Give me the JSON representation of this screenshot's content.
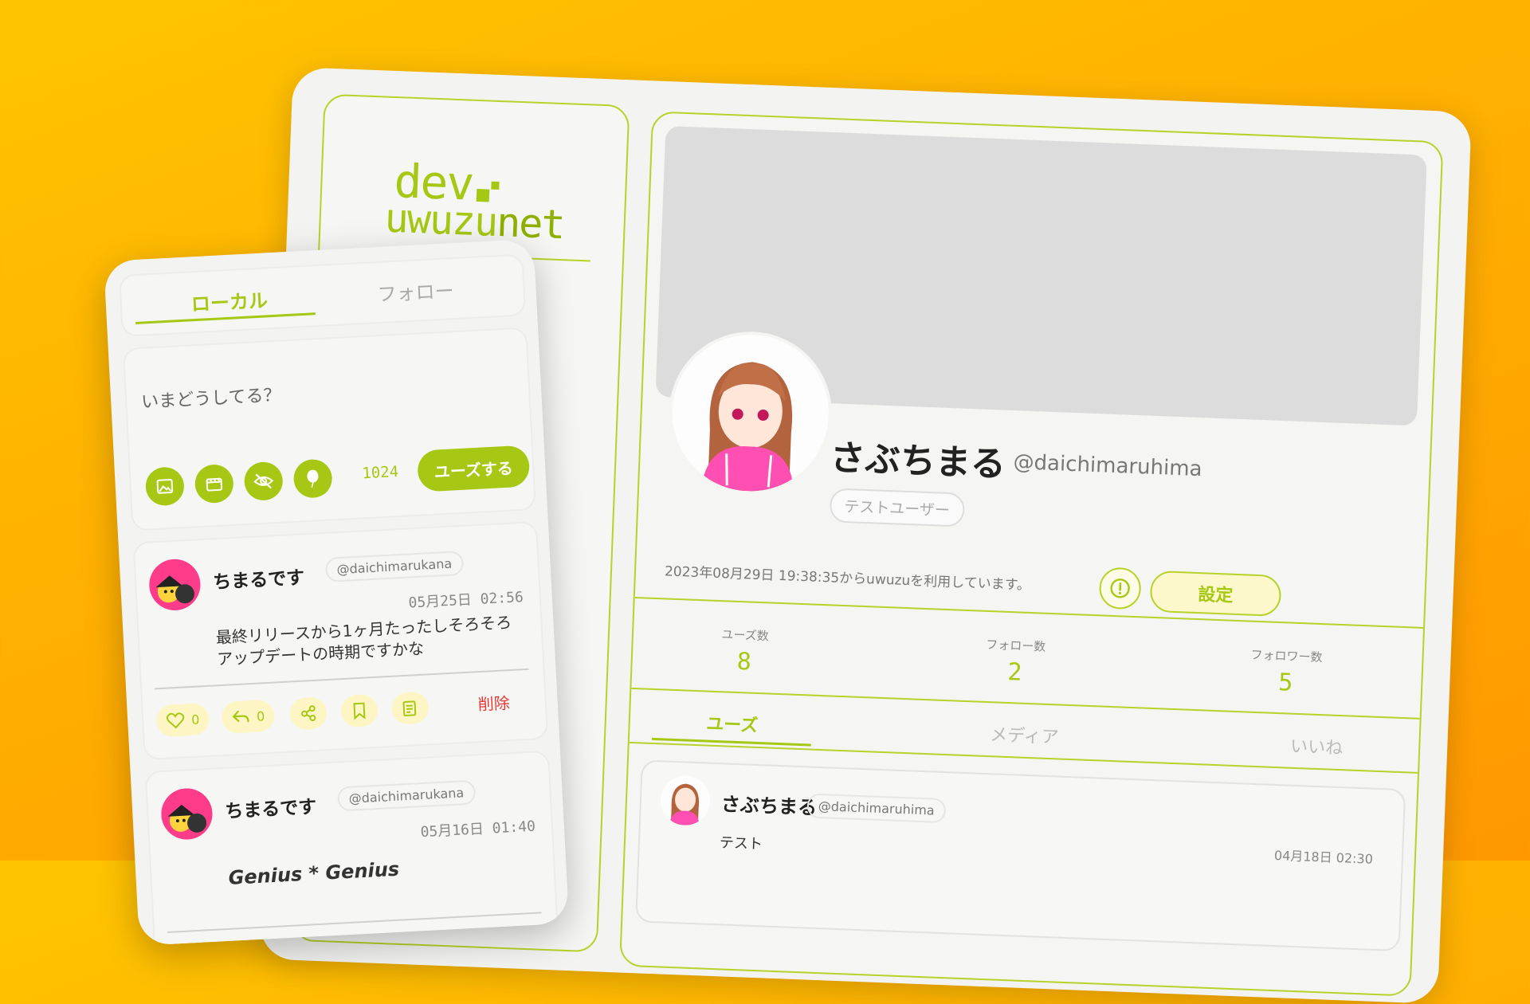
{
  "profile": {
    "logo": {
      "line1": "dev",
      "line2a": "uwuzu",
      "line2b": "net"
    },
    "display_name": "さぶちまる",
    "handle": "@daichimaruhima",
    "role_badge": "テストユーザー",
    "joined_text": "2023年08月29日 19:38:35からuwuzuを利用しています。",
    "settings_label": "設定",
    "stats": [
      {
        "label": "ユーズ数",
        "value": "8"
      },
      {
        "label": "フォロー数",
        "value": "2"
      },
      {
        "label": "フォロワー数",
        "value": "5"
      }
    ],
    "tabs": [
      "ユーズ",
      "メディア",
      "いいね"
    ],
    "post": {
      "name": "さぶちまる",
      "handle": "@daichimaruhima",
      "date": "04月18日 02:30",
      "text": "テスト"
    }
  },
  "timeline": {
    "tabs": {
      "local": "ローカル",
      "follow": "フォロー"
    },
    "composer": {
      "placeholder": "いまどうしてる？",
      "char_count": "1024",
      "post_label": "ユーズする",
      "icons": [
        "image-icon",
        "video-icon",
        "eye-off-icon",
        "balloon-icon"
      ]
    },
    "posts": [
      {
        "name": "ちまるです",
        "handle": "@daichimarukana",
        "date": "05月25日 02:56",
        "text": "最終リリースから1ヶ月たったしそろそろアップデートの時期ですかな",
        "likes": "0",
        "replies": "0",
        "delete_label": "削除"
      },
      {
        "name": "ちまるです",
        "handle": "@daichimarukana",
        "date": "05月16日 01:40",
        "text": "Genius * Genius"
      }
    ]
  },
  "colors": {
    "accent": "#a6c814",
    "background": "#ffb300",
    "danger": "#e53935"
  }
}
